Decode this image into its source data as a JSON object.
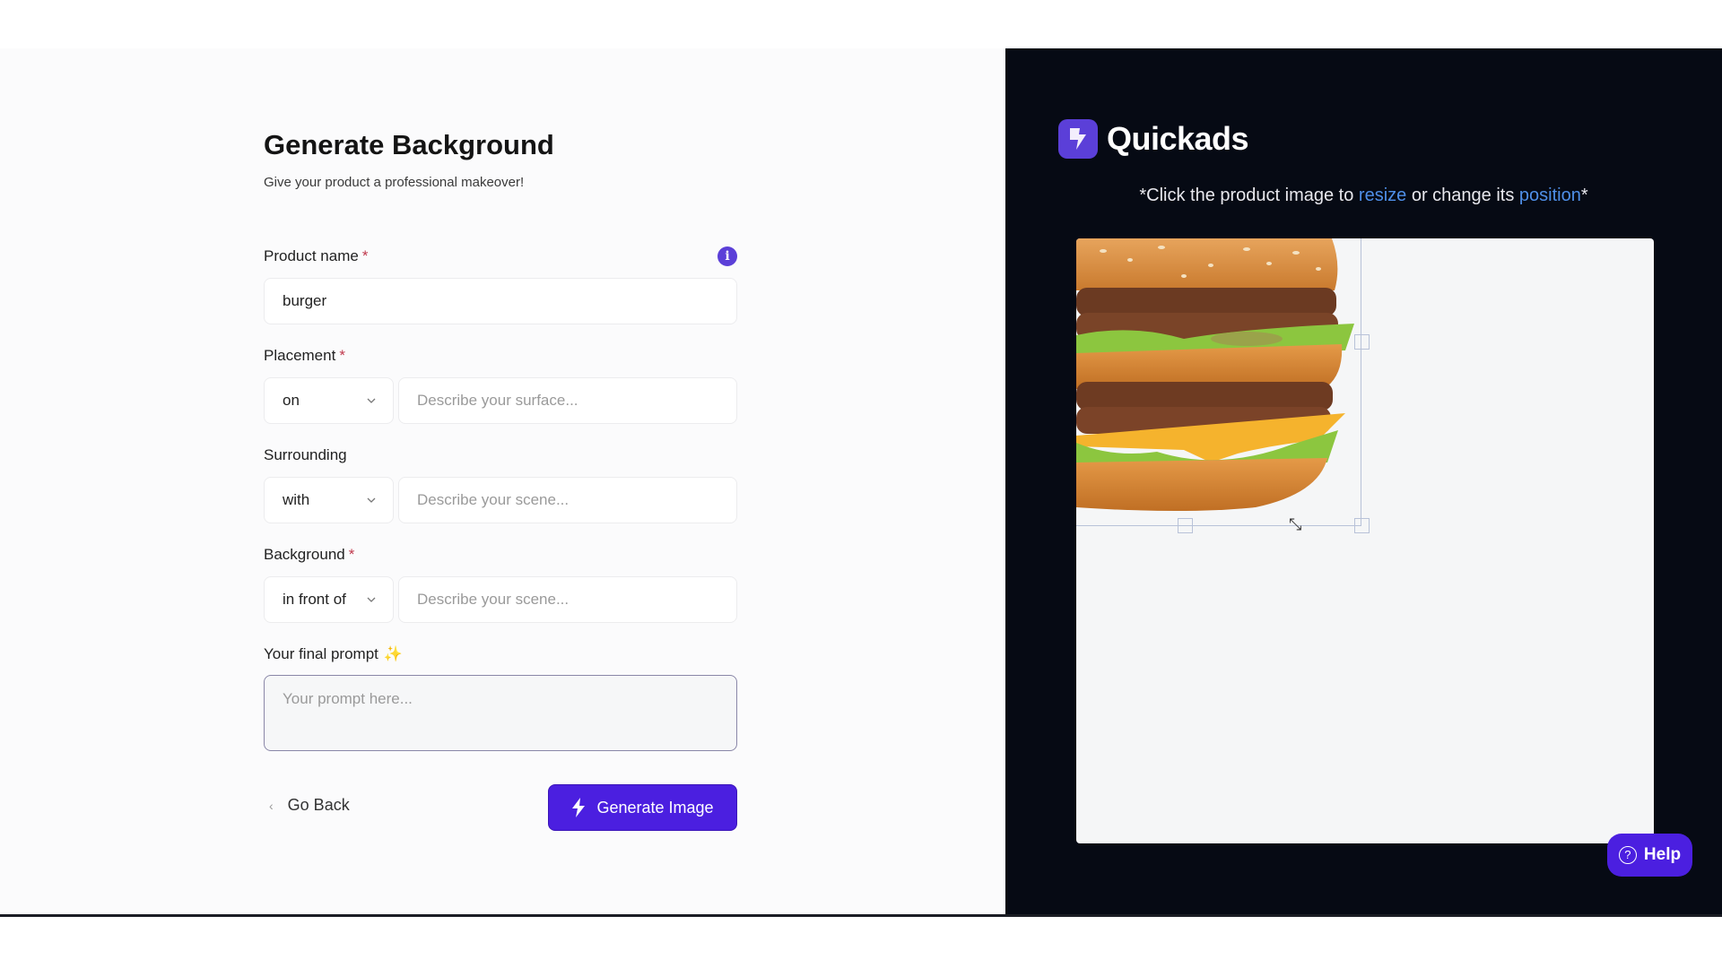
{
  "form": {
    "title": "Generate Background",
    "subtitle": "Give your product a professional makeover!",
    "product_name": {
      "label": "Product name",
      "required_mark": "*",
      "value": "burger",
      "info_icon": "info-icon"
    },
    "placement": {
      "label": "Placement",
      "required_mark": "*",
      "select_value": "on",
      "placeholder": "Describe your surface..."
    },
    "surrounding": {
      "label": "Surrounding",
      "select_value": "with",
      "placeholder": "Describe your scene..."
    },
    "background": {
      "label": "Background",
      "required_mark": "*",
      "select_value": "in front of",
      "placeholder": "Describe your scene..."
    },
    "final_prompt": {
      "label": "Your final prompt",
      "sparkle": "✨",
      "placeholder": "Your prompt here..."
    },
    "go_back_label": "Go Back",
    "generate_label": "Generate Image"
  },
  "preview": {
    "brand_name": "Quickads",
    "hint_prefix": "*Click the product image to ",
    "hint_link1": "resize",
    "hint_middle": " or change its ",
    "hint_link2": "position",
    "hint_suffix": "*",
    "product_image_alt": "burger product image",
    "help_label": "Help"
  },
  "colors": {
    "accent": "#4b1fe0",
    "brand": "#5b3fd8",
    "dark_panel": "#060a14",
    "link": "#4f8fe8",
    "required": "#c0394d"
  }
}
